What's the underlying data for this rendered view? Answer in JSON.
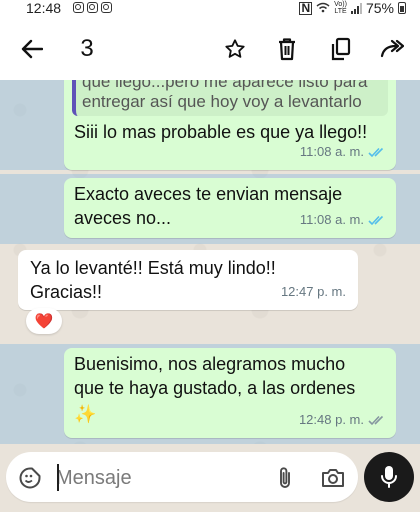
{
  "status_bar": {
    "time": "12:48",
    "battery": "75%",
    "lte_label": "LTE",
    "volte_label": "Vo))"
  },
  "app_bar": {
    "selected_count": "3",
    "back_icon": "arrow-back-icon",
    "star_icon": "star-icon",
    "delete_icon": "trash-icon",
    "copy_icon": "copy-icon",
    "forward_icon": "forward-icon"
  },
  "messages": [
    {
      "direction": "outgoing",
      "quoted_text_line1": "que llego...pero me aparece listo para",
      "quoted_text_line2": "entregar así que hoy voy a levantarlo",
      "text": "Siii lo mas probable es que ya llego!!",
      "time": "11:08 a. m.",
      "status": "read",
      "selected": true
    },
    {
      "direction": "outgoing",
      "text_line1": "Exacto aveces te envian mensaje",
      "text_line2": "aveces no...",
      "time": "11:08 a. m.",
      "status": "read",
      "selected": true
    },
    {
      "direction": "incoming",
      "text_line1": "Ya lo levanté!! Está muy lindo!!",
      "text_line2": "Gracias!!",
      "time": "12:47 p. m.",
      "reaction": "❤️",
      "selected": false
    },
    {
      "direction": "outgoing",
      "text_line1": "Buenisimo, nos alegramos mucho",
      "text_line2": "que te haya gustado, a las ordenes",
      "emoji": "✨",
      "time": "12:48 p. m.",
      "status": "delivered",
      "selected": true
    }
  ],
  "composer": {
    "placeholder": "Mensaje",
    "emoji_icon": "sticker-emoji-icon",
    "attach_icon": "paperclip-icon",
    "camera_icon": "camera-icon",
    "mic_icon": "microphone-icon"
  },
  "colors": {
    "outgoing_bubble": "#d9fdd3",
    "incoming_bubble": "#ffffff",
    "selection_overlay": "#7fb5dd",
    "read_ticks": "#53bdeb",
    "quote_bar": "#5f52b8"
  }
}
